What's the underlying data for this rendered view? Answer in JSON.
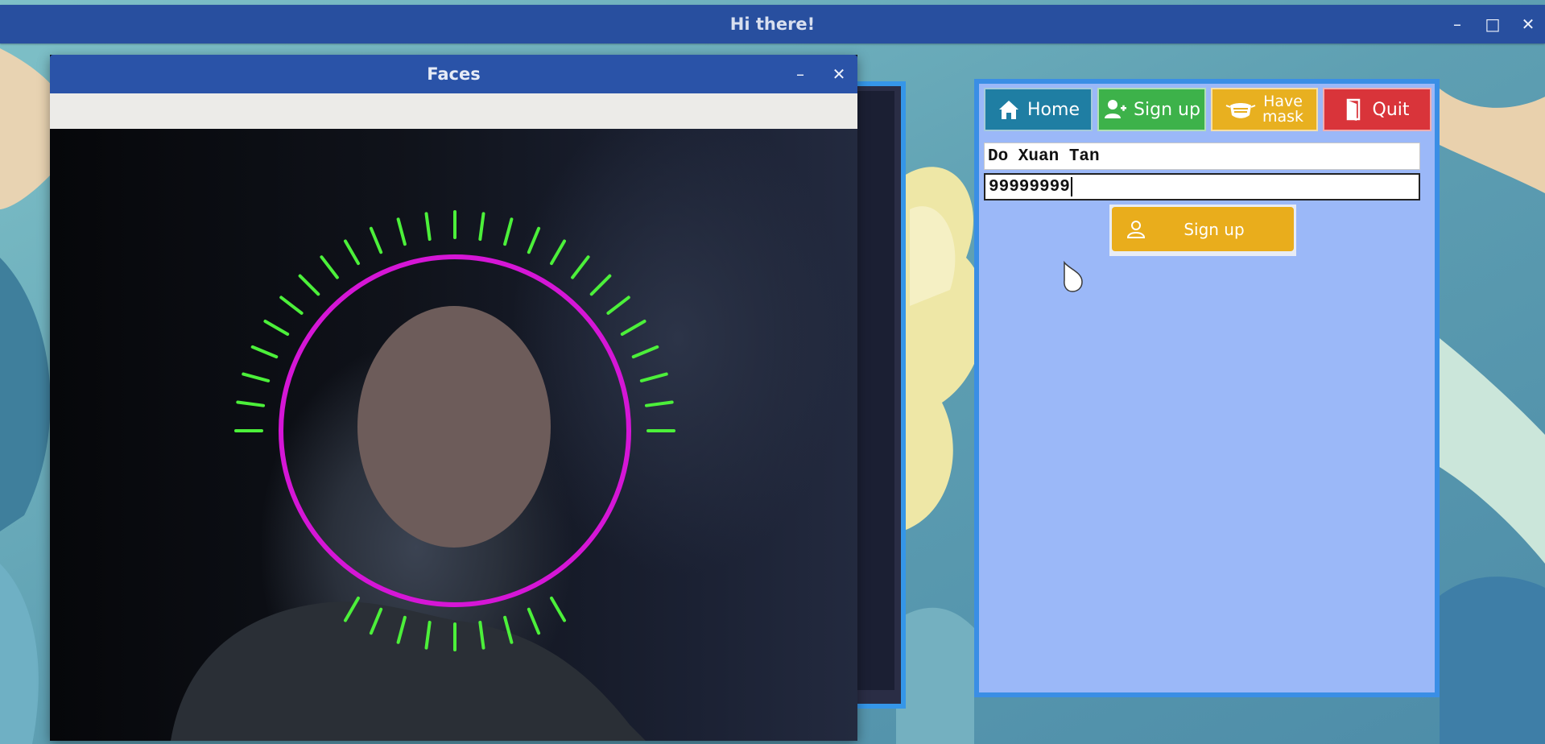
{
  "main_window": {
    "title": "Hi there!",
    "controls": {
      "minimize": "–",
      "maximize": "□",
      "close": "✕"
    }
  },
  "faces_window": {
    "title": "Faces",
    "controls": {
      "minimize": "–",
      "close": "✕"
    },
    "overlay": {
      "ring_color": "#d516d6",
      "ticks_color": "#4cf03a"
    }
  },
  "signup_panel": {
    "nav": {
      "home": "Home",
      "signup": "Sign up",
      "mask_line1": "Have",
      "mask_line2": "mask",
      "quit": "Quit"
    },
    "name_field": {
      "value": "Do Xuan Tan"
    },
    "id_field": {
      "value": "99999999"
    },
    "submit_label": "Sign up"
  },
  "colors": {
    "titlebar": "#284f9f",
    "panel_bg": "#9bb8f8",
    "panel_border": "#3a8ee5",
    "home": "#1f7ea3",
    "signup": "#3db24a",
    "mask": "#e8b020",
    "quit": "#d9343a",
    "submit": "#e9ad1c"
  }
}
